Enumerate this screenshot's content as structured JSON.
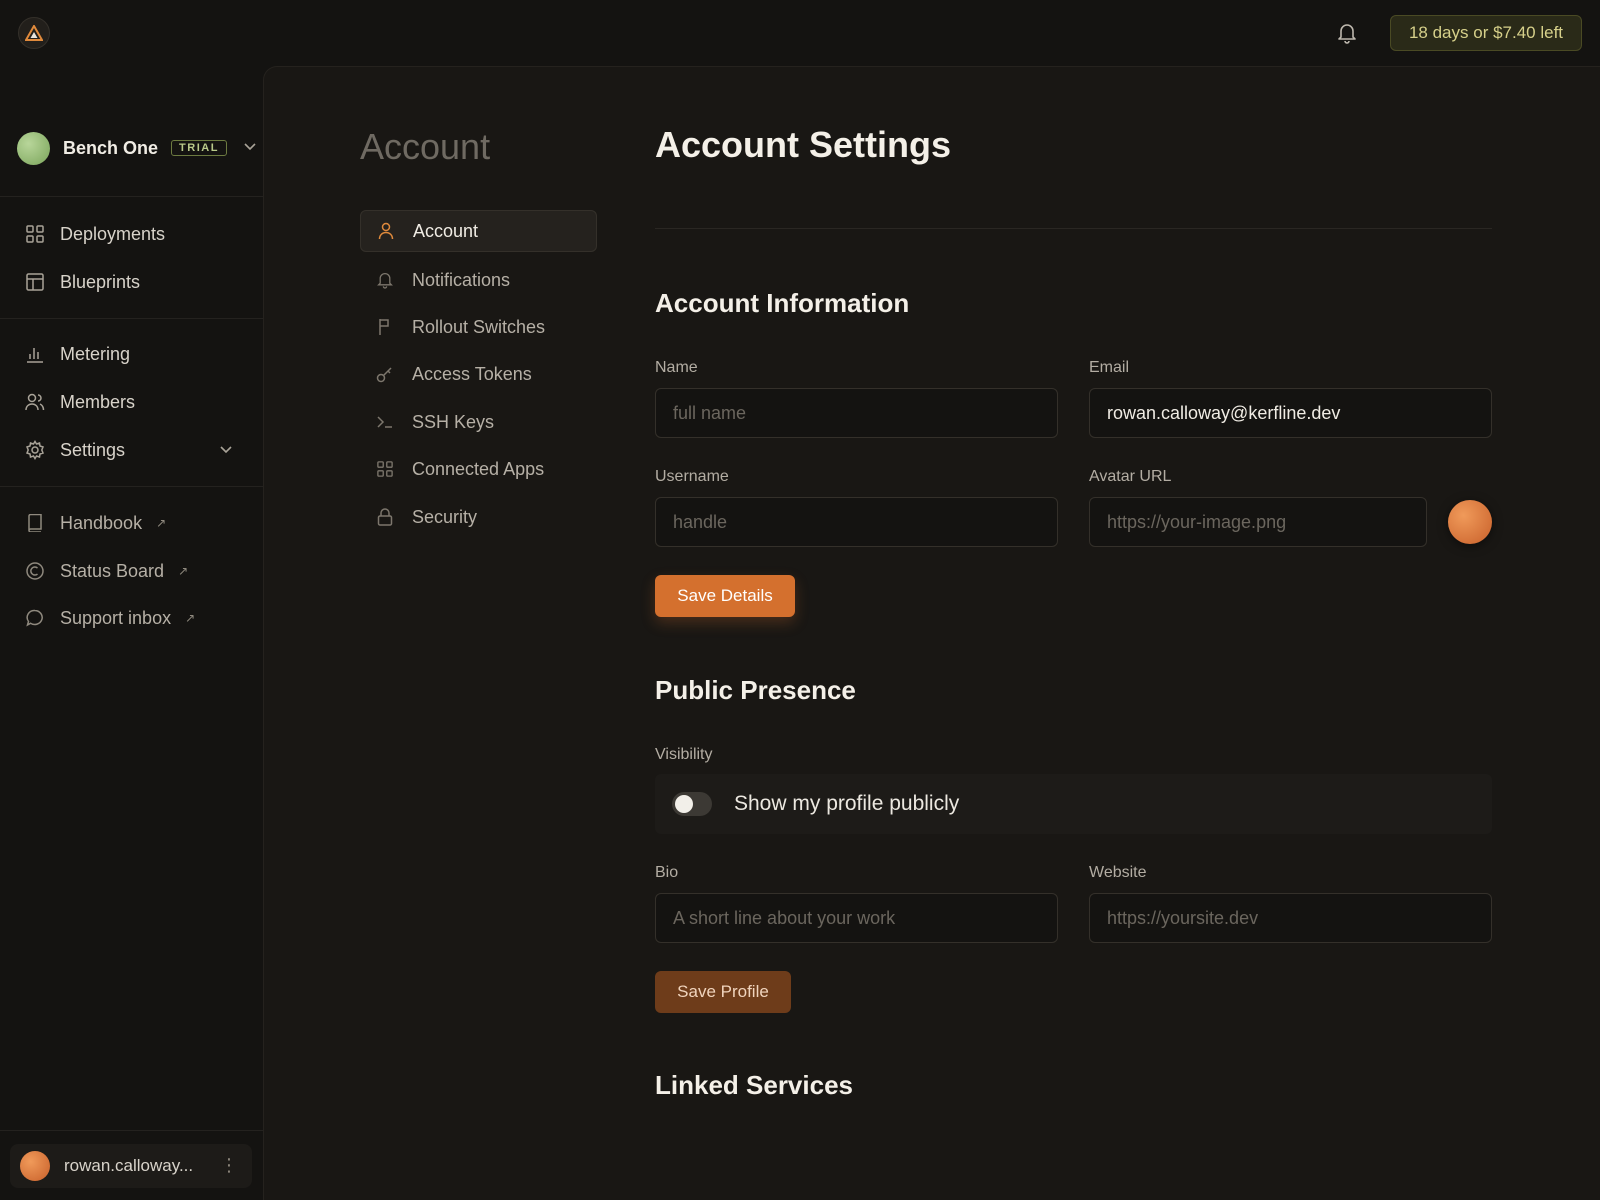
{
  "topbar": {
    "trial_text": "18 days or $7.40 left"
  },
  "sidebar": {
    "org": {
      "name": "Bench One",
      "badge": "TRIAL"
    },
    "items": [
      {
        "label": "Deployments",
        "icon": "grid-icon"
      },
      {
        "label": "Blueprints",
        "icon": "layout-icon"
      },
      {
        "label": "Metering",
        "icon": "bar-chart-icon"
      },
      {
        "label": "Members",
        "icon": "users-icon"
      },
      {
        "label": "Settings",
        "icon": "gear-icon"
      },
      {
        "label": "Handbook",
        "icon": "book-icon",
        "external": true
      },
      {
        "label": "Status Board",
        "icon": "status-icon",
        "external": true
      },
      {
        "label": "Support inbox",
        "icon": "chat-icon",
        "external": true
      }
    ],
    "user": {
      "name": "rowan.calloway..."
    }
  },
  "subnav": {
    "title": "Account",
    "items": [
      {
        "label": "Account",
        "icon": "user-icon",
        "active": true
      },
      {
        "label": "Notifications",
        "icon": "bell-icon"
      },
      {
        "label": "Rollout Switches",
        "icon": "flag-icon"
      },
      {
        "label": "Access Tokens",
        "icon": "key-icon"
      },
      {
        "label": "SSH Keys",
        "icon": "terminal-icon"
      },
      {
        "label": "Connected Apps",
        "icon": "grid-icon"
      },
      {
        "label": "Security",
        "icon": "lock-icon"
      }
    ]
  },
  "main": {
    "title": "Account Settings",
    "account_info": {
      "title": "Account Information",
      "name_label": "Name",
      "name_placeholder": "full name",
      "email_label": "Email",
      "email_value": "rowan.calloway@kerfline.dev",
      "username_label": "Username",
      "username_placeholder": "handle",
      "avatar_label": "Avatar URL",
      "avatar_placeholder": "https://your-image.png",
      "save_label": "Save Details"
    },
    "public": {
      "title": "Public Presence",
      "visibility_label": "Visibility",
      "toggle_label": "Show my profile publicly",
      "toggle_on": false,
      "bio_label": "Bio",
      "bio_placeholder": "A short line about your work",
      "website_label": "Website",
      "website_placeholder": "https://yoursite.dev",
      "save_label": "Save Profile"
    },
    "linked": {
      "title": "Linked Services"
    }
  },
  "colors": {
    "accent": "#d4702e",
    "background": "#141311",
    "panel": "#191714"
  }
}
